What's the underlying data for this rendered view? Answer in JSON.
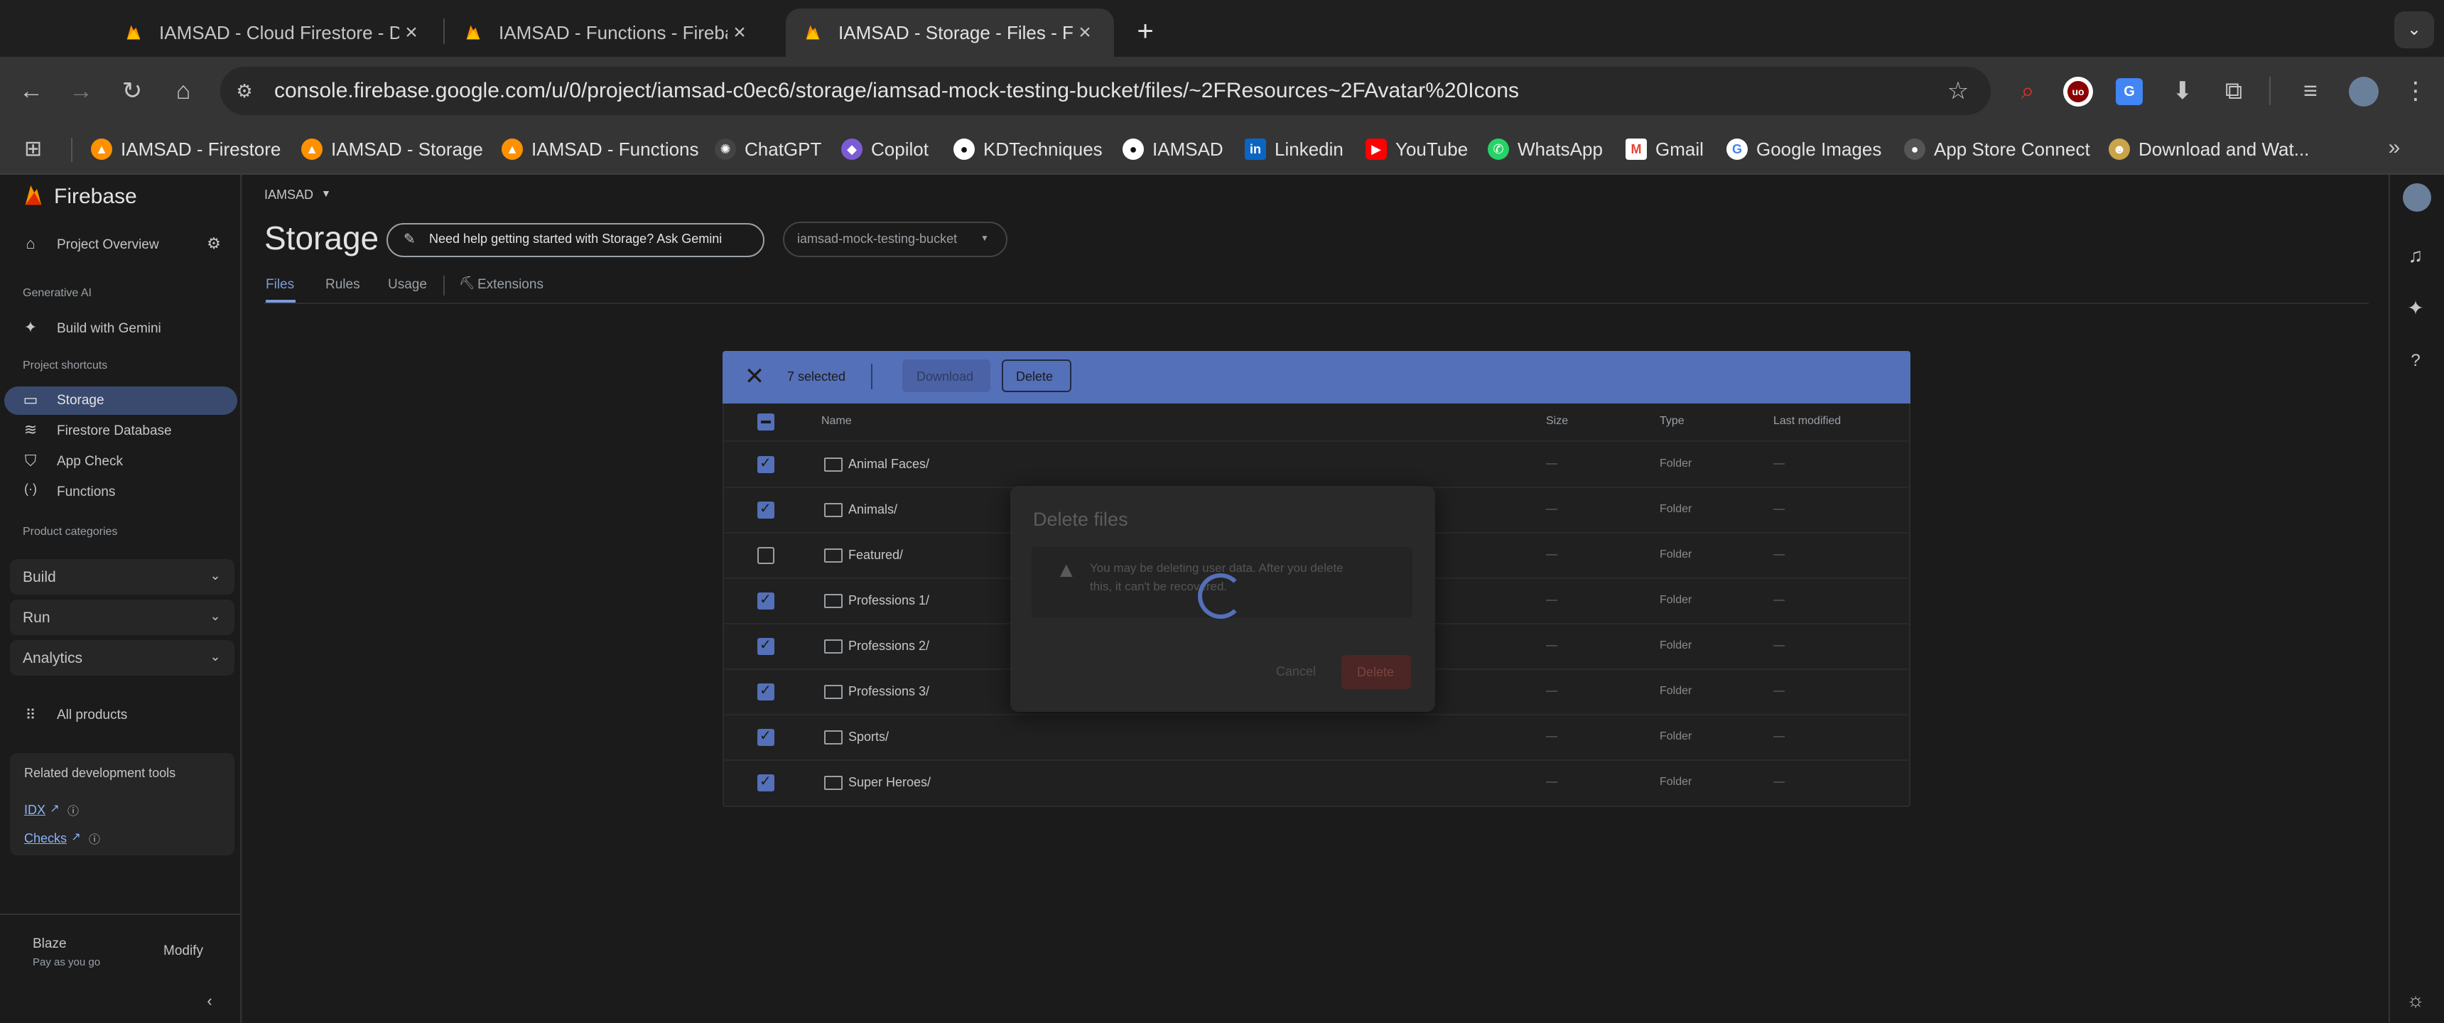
{
  "browser": {
    "tabs": [
      {
        "title": "IAMSAD - Cloud Firestore - D",
        "active": false
      },
      {
        "title": "IAMSAD - Functions - Firebas",
        "active": false
      },
      {
        "title": "IAMSAD - Storage - Files - Fi",
        "active": true
      }
    ],
    "new_tab": "+",
    "url": "console.firebase.google.com/u/0/project/iamsad-c0ec6/storage/iamsad-mock-testing-bucket/files/~2FResources~2FAvatar%20Icons",
    "bookmarks": [
      "IAMSAD - Firestore",
      "IAMSAD - Storage",
      "IAMSAD - Functions",
      "ChatGPT",
      "Copilot",
      "KDTechniques",
      "IAMSAD",
      "Linkedin",
      "YouTube",
      "WhatsApp",
      "Gmail",
      "Google Images",
      "App Store Connect",
      "Download and Wat..."
    ]
  },
  "sidebar": {
    "brand": "Firebase",
    "project_overview": "Project Overview",
    "section_genai": "Generative AI",
    "build_with_gemini": "Build with Gemini",
    "section_shortcuts": "Project shortcuts",
    "shortcuts": [
      "Storage",
      "Firestore Database",
      "App Check",
      "Functions"
    ],
    "section_categories": "Product categories",
    "categories": [
      "Build",
      "Run",
      "Analytics"
    ],
    "all_products": "All products",
    "related_title": "Related development tools",
    "related_links": [
      "IDX",
      "Checks"
    ],
    "plan_name": "Blaze",
    "plan_desc": "Pay as you go",
    "modify": "Modify"
  },
  "header": {
    "project": "IAMSAD",
    "title": "Storage",
    "gemini_prompt": "Need help getting started with Storage? Ask Gemini",
    "bucket": "iamsad-mock-testing-bucket",
    "tabs": [
      "Files",
      "Rules",
      "Usage",
      "Extensions"
    ]
  },
  "selection_bar": {
    "count": "7 selected",
    "download": "Download",
    "delete": "Delete"
  },
  "table": {
    "headers": {
      "name": "Name",
      "size": "Size",
      "type": "Type",
      "modified": "Last modified"
    },
    "rows": [
      {
        "name": "Animal Faces/",
        "size": "—",
        "type": "Folder",
        "modified": "—",
        "checked": true
      },
      {
        "name": "Animals/",
        "size": "—",
        "type": "Folder",
        "modified": "—",
        "checked": true
      },
      {
        "name": "Featured/",
        "size": "—",
        "type": "Folder",
        "modified": "—",
        "checked": false
      },
      {
        "name": "Professions 1/",
        "size": "—",
        "type": "Folder",
        "modified": "—",
        "checked": true
      },
      {
        "name": "Professions 2/",
        "size": "—",
        "type": "Folder",
        "modified": "—",
        "checked": true
      },
      {
        "name": "Professions 3/",
        "size": "—",
        "type": "Folder",
        "modified": "—",
        "checked": true
      },
      {
        "name": "Sports/",
        "size": "—",
        "type": "Folder",
        "modified": "—",
        "checked": true
      },
      {
        "name": "Super Heroes/",
        "size": "—",
        "type": "Folder",
        "modified": "—",
        "checked": true
      }
    ]
  },
  "dialog": {
    "title": "Delete files",
    "warning_line1": "You may be deleting user data. After you delete",
    "warning_line2": "this, it can't be recovered.",
    "cancel": "Cancel",
    "delete": "Delete"
  },
  "colors": {
    "accent": "#5470b8",
    "danger": "#b3261e",
    "firebase": "#ff9100"
  }
}
